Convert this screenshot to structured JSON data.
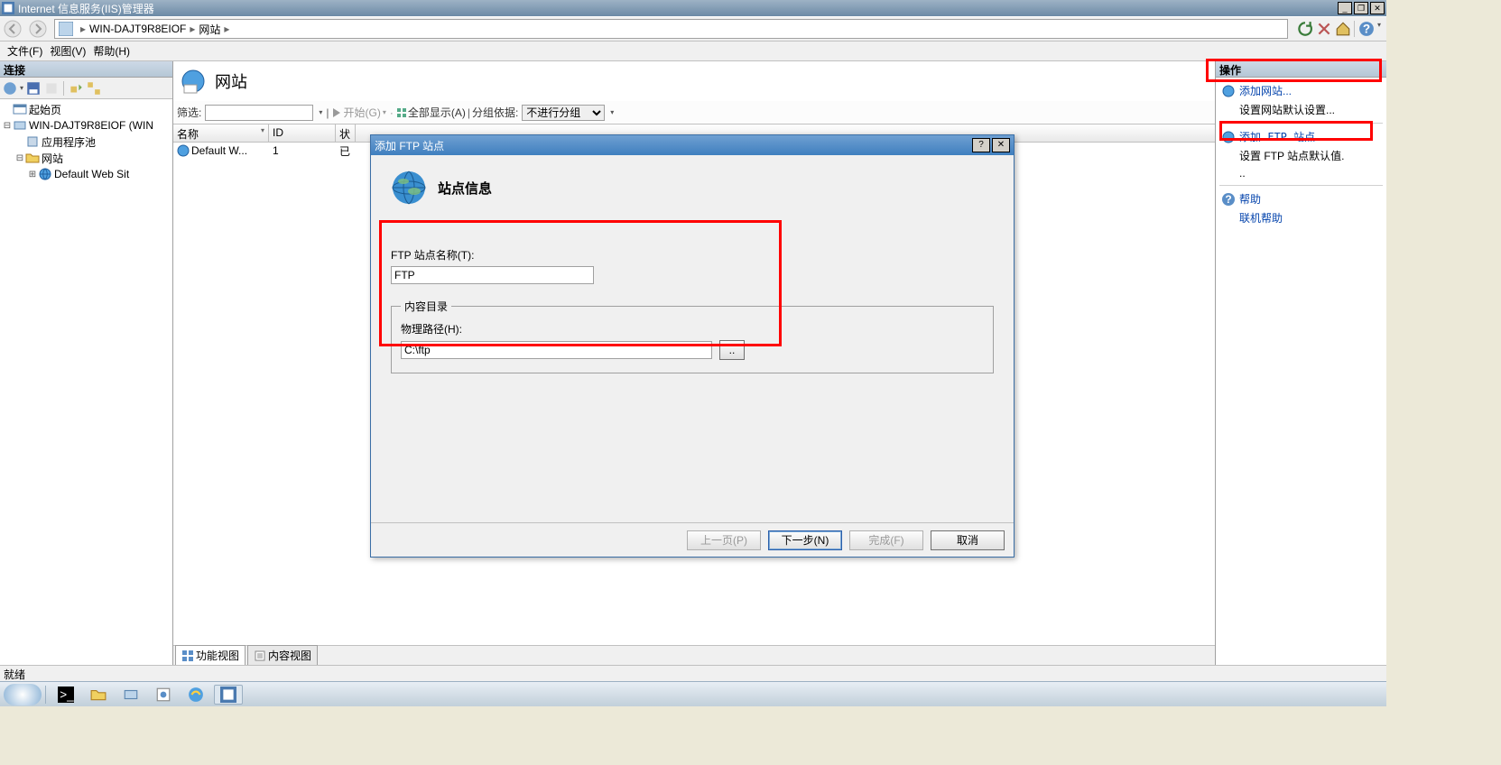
{
  "window": {
    "title": "Internet 信息服务(IIS)管理器"
  },
  "breadcrumb": {
    "server": "WIN-DAJT9R8EIOF",
    "node": "网站"
  },
  "menu": {
    "file": "文件(F)",
    "view": "视图(V)",
    "help": "帮助(H)"
  },
  "left": {
    "header": "连接",
    "tree": {
      "start": "起始页",
      "server": "WIN-DAJT9R8EIOF (WIN",
      "pool": "应用程序池",
      "sites": "网站",
      "default": "Default Web Sit"
    }
  },
  "center": {
    "title": "网站",
    "filter_label": "筛选:",
    "go_label": "开始(G)",
    "showall": "全部显示(A)",
    "groupby": "分组依据:",
    "group_value": "不进行分组",
    "cols": {
      "name": "名称",
      "id": "ID",
      "status": "状"
    },
    "row": {
      "name": "Default W...",
      "id": "1",
      "status": "已"
    },
    "tab1": "功能视图",
    "tab2": "内容视图"
  },
  "right": {
    "header": "操作",
    "add_site": "添加网站...",
    "set_defaults": "设置网站默认设置...",
    "add_ftp": "添加 FTP 站点...",
    "set_ftp_defaults": "设置 FTP 站点默认值.",
    "set_ftp_defaults2": "..",
    "help": "帮助",
    "online_help": "联机帮助"
  },
  "dialog": {
    "title": "添加 FTP 站点",
    "heading": "站点信息",
    "site_name_label": "FTP 站点名称(T):",
    "site_name_value": "FTP",
    "content_dir": "内容目录",
    "path_label": "物理路径(H):",
    "path_value": "C:\\ftp",
    "browse": "..",
    "prev": "上一页(P)",
    "next": "下一步(N)",
    "finish": "完成(F)",
    "cancel": "取消",
    "help_btn": "?",
    "close_btn": "✕"
  },
  "status": "就绪"
}
